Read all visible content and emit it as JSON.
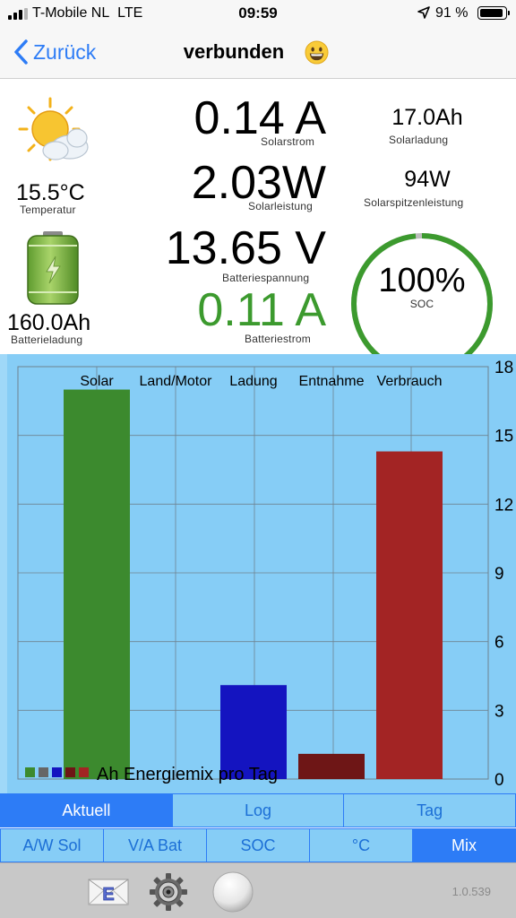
{
  "status_bar": {
    "carrier": "T-Mobile NL",
    "network": "LTE",
    "time": "09:59",
    "battery_percent": "91 %",
    "battery_level": 0.91
  },
  "nav": {
    "back_label": "Zurück",
    "title": "verbunden",
    "title_icon": "grinning-face-emoji"
  },
  "readouts": {
    "temperature": {
      "value": "15.5°C",
      "label": "Temperatur",
      "icon": "sun-cloud-icon"
    },
    "battery_charge": {
      "value": "160.0Ah",
      "label": "Batterieladung",
      "icon": "battery-charging-icon"
    },
    "solar_current": {
      "value": "0.14 A",
      "label": "Solarstrom"
    },
    "solar_power": {
      "value": "2.03W",
      "label": "Solarleistung"
    },
    "battery_voltage": {
      "value": "13.65 V",
      "label": "Batteriespannung"
    },
    "battery_current": {
      "value": "0.11 A",
      "label": "Batteriestrom",
      "color": "#3c9a2e"
    },
    "solar_charge": {
      "value": "17.0Ah",
      "label": "Solarladung"
    },
    "solar_peak": {
      "value": "94W",
      "label": "Solarspitzenleistung"
    },
    "soc": {
      "value": "100%",
      "label": "SOC",
      "level": 0.985,
      "ring_color": "#3c9a2e"
    }
  },
  "chart_data": {
    "type": "bar",
    "categories": [
      "Solar",
      "Land/Motor",
      "Ladung",
      "Entnahme",
      "Verbrauch"
    ],
    "values": [
      17.0,
      0,
      4.1,
      1.1,
      14.3
    ],
    "colors": [
      "#3c8a2e",
      "#666666",
      "#1414c0",
      "#6e1616",
      "#a32424"
    ],
    "ylim": [
      0,
      18
    ],
    "yticks": [
      0,
      3,
      6,
      9,
      12,
      15,
      18
    ],
    "y_axis_side": "right",
    "legend_text": "Ah Energiemix pro Tag",
    "legend_placement": "bottom-left",
    "grid": true
  },
  "tabs_row1": [
    {
      "label": "Aktuell",
      "active": true
    },
    {
      "label": "Log",
      "active": false
    },
    {
      "label": "Tag",
      "active": false
    }
  ],
  "tabs_row2": [
    {
      "label": "A/W Sol",
      "active": false
    },
    {
      "label": "V/A Bat",
      "active": false
    },
    {
      "label": "SOC",
      "active": false
    },
    {
      "label": "°C",
      "active": false
    },
    {
      "label": "Mix",
      "active": true
    }
  ],
  "toolbar": {
    "mail_icon": "mail-envelope-icon",
    "settings_icon": "gear-icon",
    "record_icon": "record-button-icon",
    "version": "1.0.539"
  },
  "colors": {
    "accent": "#2d7cf6",
    "chart_background": "#86cdf6"
  }
}
